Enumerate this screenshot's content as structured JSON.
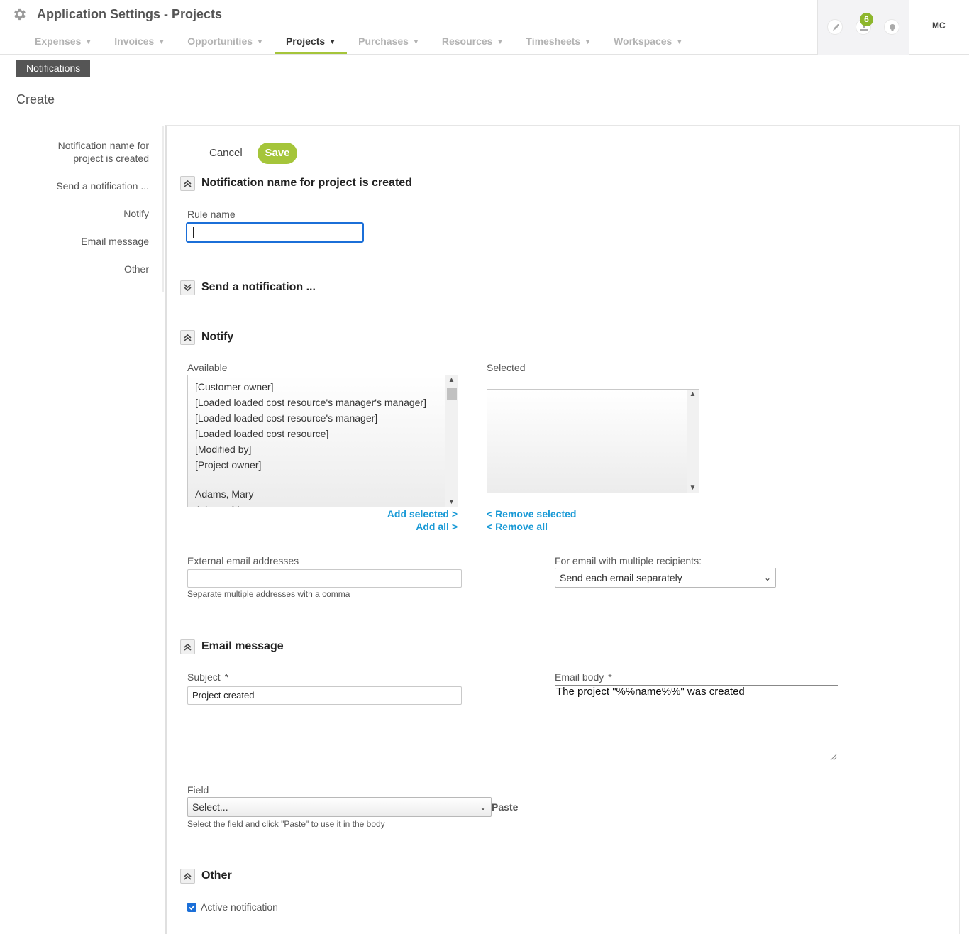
{
  "header": {
    "title": "Application Settings - Projects",
    "nav": [
      {
        "label": "Expenses",
        "active": false
      },
      {
        "label": "Invoices",
        "active": false
      },
      {
        "label": "Opportunities",
        "active": false
      },
      {
        "label": "Projects",
        "active": true
      },
      {
        "label": "Purchases",
        "active": false
      },
      {
        "label": "Resources",
        "active": false
      },
      {
        "label": "Timesheets",
        "active": false
      },
      {
        "label": "Workspaces",
        "active": false
      }
    ],
    "icons": [
      "rocket-icon",
      "inbox-icon",
      "lightbulb-icon"
    ],
    "badge_count": "6",
    "user_initials": "MC",
    "accent_color": "#a5c53a"
  },
  "subnav": {
    "notifications_tab": "Notifications"
  },
  "page": {
    "heading": "Create"
  },
  "side_nav": {
    "items": [
      "Notification name for project is created",
      "Send a notification ...",
      "Notify",
      "Email message",
      "Other"
    ]
  },
  "form": {
    "cancel_label": "Cancel",
    "save_label": "Save",
    "section_name": {
      "title": "Notification name for project is created",
      "rule_name_label": "Rule name",
      "rule_name_value": ""
    },
    "section_send": {
      "title": "Send a notification ..."
    },
    "section_notify": {
      "title": "Notify",
      "available_label": "Available",
      "selected_label": "Selected",
      "available_items": [
        "[Customer owner]",
        "[Loaded loaded cost resource's manager's manager]",
        "[Loaded loaded cost resource's manager]",
        "[Loaded loaded cost resource]",
        "[Modified by]",
        "[Project owner]",
        "",
        "Adams, Mary",
        "Adams, Mary"
      ],
      "add_selected": "Add selected >",
      "add_all": "Add all >",
      "remove_selected": "< Remove selected",
      "remove_all": "< Remove all",
      "external_label": "External email addresses",
      "external_value": "",
      "external_hint": "Separate multiple addresses with a comma",
      "multi_label": "For email with multiple recipients:",
      "multi_value": "Send each email separately"
    },
    "section_email": {
      "title": "Email message",
      "subject_label": "Subject",
      "subject_value": "Project created",
      "body_label": "Email body",
      "body_value": "The project \"%%name%%\" was created",
      "required_mark": "*",
      "field_label": "Field",
      "field_value": "Select...",
      "paste_label": "Paste",
      "field_hint": "Select the field and click \"Paste\" to use it in the body"
    },
    "section_other": {
      "title": "Other",
      "active_label": "Active notification",
      "active_checked": true
    }
  }
}
